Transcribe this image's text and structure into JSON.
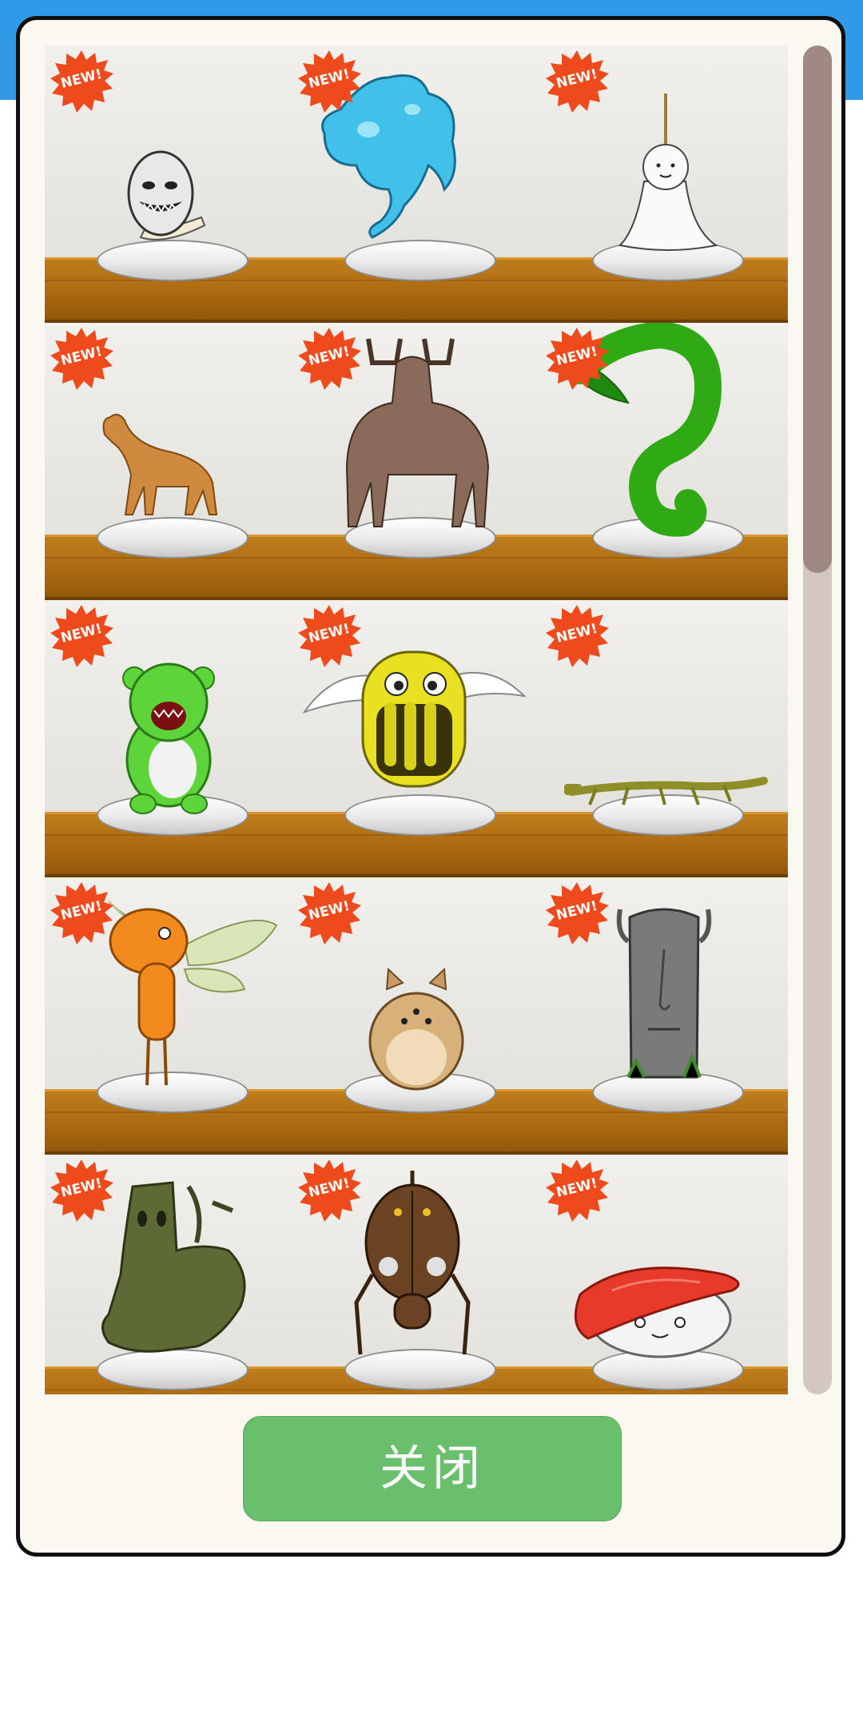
{
  "header": {
    "bar_color": "#2f9be8"
  },
  "shelf": {
    "items": [
      {
        "badge": "NEW!",
        "icon": "egg-creature-icon"
      },
      {
        "badge": "NEW!",
        "icon": "blue-slime-creature-icon"
      },
      {
        "badge": "NEW!",
        "icon": "ghost-doll-creature-icon"
      },
      {
        "badge": "NEW!",
        "icon": "horse-creature-icon"
      },
      {
        "badge": "NEW!",
        "icon": "moose-creature-icon"
      },
      {
        "badge": "NEW!",
        "icon": "green-worm-creature-icon"
      },
      {
        "badge": "NEW!",
        "icon": "green-bear-creature-icon"
      },
      {
        "badge": "NEW!",
        "icon": "winged-mouth-creature-icon"
      },
      {
        "badge": "NEW!",
        "icon": "stick-insect-creature-icon"
      },
      {
        "badge": "NEW!",
        "icon": "orange-fairy-creature-icon"
      },
      {
        "badge": "NEW!",
        "icon": "hamster-creature-icon"
      },
      {
        "badge": "NEW!",
        "icon": "moai-creature-icon"
      },
      {
        "badge": "NEW!",
        "icon": "tree-creature-icon"
      },
      {
        "badge": "NEW!",
        "icon": "beetle-creature-icon"
      },
      {
        "badge": "NEW!",
        "icon": "sushi-creature-icon"
      }
    ]
  },
  "scrollbar": {
    "thumb_fraction": 0.39,
    "position_fraction": 0.0
  },
  "close_button": {
    "label": "关闭"
  },
  "colors": {
    "badge": "#ee4a1c",
    "button": "#6abf6c",
    "plank": "#b07015",
    "frame": "#0f0f0f"
  }
}
